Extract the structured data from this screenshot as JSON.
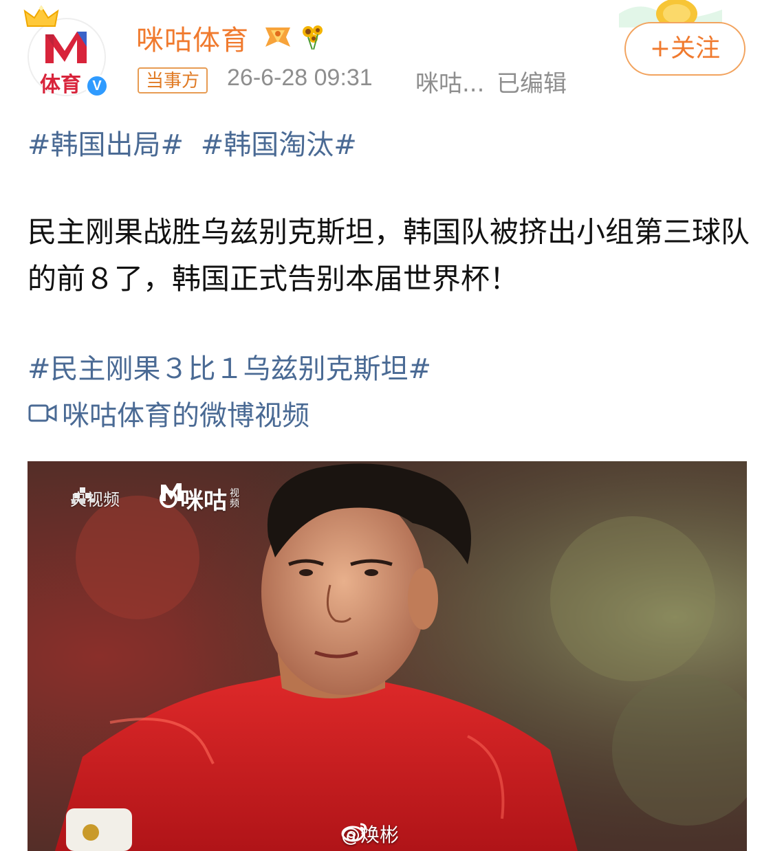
{
  "header": {
    "username": "咪咕体育",
    "avatar_text": "体育",
    "party_tag": "当事方",
    "timestamp": "26-6-28 09:31",
    "source": "咪咕...",
    "edited": "已编辑",
    "follow_label": "+关注"
  },
  "post": {
    "topics": [
      "#韩国出局#",
      "#韩国淘汰#"
    ],
    "text": "民主刚果战胜乌兹别克斯坦，韩国队被挤出小组第三球队的前８了，韩国正式告别本届世界杯！",
    "topic_score": "#民主刚果３比１乌兹别克斯坦#",
    "video_link": "咪咕体育的微博视频"
  },
  "video": {
    "watermark_cctv": "央视频",
    "watermark_migu": "咪咕",
    "watermark_migu_small": "视频",
    "watermark_weibo": "@焕彬"
  },
  "colors": {
    "brand_orange": "#f07a2e",
    "link_blue": "#4a6a94",
    "meta_gray": "#8e8e8e",
    "verified_blue": "#2f9bff"
  },
  "icons": {
    "crown": "crown-icon",
    "verified": "verified-icon",
    "member_badge": "member-badge-icon",
    "flower_badge": "sunflower-badge-icon",
    "video_link": "video-camera-icon",
    "weibo": "weibo-logo-icon"
  }
}
